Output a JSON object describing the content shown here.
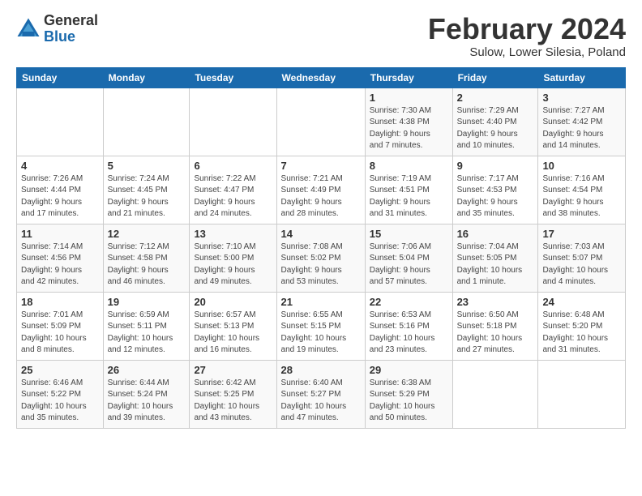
{
  "header": {
    "logo_general": "General",
    "logo_blue": "Blue",
    "month_title": "February 2024",
    "location": "Sulow, Lower Silesia, Poland"
  },
  "calendar": {
    "days_of_week": [
      "Sunday",
      "Monday",
      "Tuesday",
      "Wednesday",
      "Thursday",
      "Friday",
      "Saturday"
    ],
    "weeks": [
      [
        {
          "day": "",
          "info": ""
        },
        {
          "day": "",
          "info": ""
        },
        {
          "day": "",
          "info": ""
        },
        {
          "day": "",
          "info": ""
        },
        {
          "day": "1",
          "info": "Sunrise: 7:30 AM\nSunset: 4:38 PM\nDaylight: 9 hours\nand 7 minutes."
        },
        {
          "day": "2",
          "info": "Sunrise: 7:29 AM\nSunset: 4:40 PM\nDaylight: 9 hours\nand 10 minutes."
        },
        {
          "day": "3",
          "info": "Sunrise: 7:27 AM\nSunset: 4:42 PM\nDaylight: 9 hours\nand 14 minutes."
        }
      ],
      [
        {
          "day": "4",
          "info": "Sunrise: 7:26 AM\nSunset: 4:44 PM\nDaylight: 9 hours\nand 17 minutes."
        },
        {
          "day": "5",
          "info": "Sunrise: 7:24 AM\nSunset: 4:45 PM\nDaylight: 9 hours\nand 21 minutes."
        },
        {
          "day": "6",
          "info": "Sunrise: 7:22 AM\nSunset: 4:47 PM\nDaylight: 9 hours\nand 24 minutes."
        },
        {
          "day": "7",
          "info": "Sunrise: 7:21 AM\nSunset: 4:49 PM\nDaylight: 9 hours\nand 28 minutes."
        },
        {
          "day": "8",
          "info": "Sunrise: 7:19 AM\nSunset: 4:51 PM\nDaylight: 9 hours\nand 31 minutes."
        },
        {
          "day": "9",
          "info": "Sunrise: 7:17 AM\nSunset: 4:53 PM\nDaylight: 9 hours\nand 35 minutes."
        },
        {
          "day": "10",
          "info": "Sunrise: 7:16 AM\nSunset: 4:54 PM\nDaylight: 9 hours\nand 38 minutes."
        }
      ],
      [
        {
          "day": "11",
          "info": "Sunrise: 7:14 AM\nSunset: 4:56 PM\nDaylight: 9 hours\nand 42 minutes."
        },
        {
          "day": "12",
          "info": "Sunrise: 7:12 AM\nSunset: 4:58 PM\nDaylight: 9 hours\nand 46 minutes."
        },
        {
          "day": "13",
          "info": "Sunrise: 7:10 AM\nSunset: 5:00 PM\nDaylight: 9 hours\nand 49 minutes."
        },
        {
          "day": "14",
          "info": "Sunrise: 7:08 AM\nSunset: 5:02 PM\nDaylight: 9 hours\nand 53 minutes."
        },
        {
          "day": "15",
          "info": "Sunrise: 7:06 AM\nSunset: 5:04 PM\nDaylight: 9 hours\nand 57 minutes."
        },
        {
          "day": "16",
          "info": "Sunrise: 7:04 AM\nSunset: 5:05 PM\nDaylight: 10 hours\nand 1 minute."
        },
        {
          "day": "17",
          "info": "Sunrise: 7:03 AM\nSunset: 5:07 PM\nDaylight: 10 hours\nand 4 minutes."
        }
      ],
      [
        {
          "day": "18",
          "info": "Sunrise: 7:01 AM\nSunset: 5:09 PM\nDaylight: 10 hours\nand 8 minutes."
        },
        {
          "day": "19",
          "info": "Sunrise: 6:59 AM\nSunset: 5:11 PM\nDaylight: 10 hours\nand 12 minutes."
        },
        {
          "day": "20",
          "info": "Sunrise: 6:57 AM\nSunset: 5:13 PM\nDaylight: 10 hours\nand 16 minutes."
        },
        {
          "day": "21",
          "info": "Sunrise: 6:55 AM\nSunset: 5:15 PM\nDaylight: 10 hours\nand 19 minutes."
        },
        {
          "day": "22",
          "info": "Sunrise: 6:53 AM\nSunset: 5:16 PM\nDaylight: 10 hours\nand 23 minutes."
        },
        {
          "day": "23",
          "info": "Sunrise: 6:50 AM\nSunset: 5:18 PM\nDaylight: 10 hours\nand 27 minutes."
        },
        {
          "day": "24",
          "info": "Sunrise: 6:48 AM\nSunset: 5:20 PM\nDaylight: 10 hours\nand 31 minutes."
        }
      ],
      [
        {
          "day": "25",
          "info": "Sunrise: 6:46 AM\nSunset: 5:22 PM\nDaylight: 10 hours\nand 35 minutes."
        },
        {
          "day": "26",
          "info": "Sunrise: 6:44 AM\nSunset: 5:24 PM\nDaylight: 10 hours\nand 39 minutes."
        },
        {
          "day": "27",
          "info": "Sunrise: 6:42 AM\nSunset: 5:25 PM\nDaylight: 10 hours\nand 43 minutes."
        },
        {
          "day": "28",
          "info": "Sunrise: 6:40 AM\nSunset: 5:27 PM\nDaylight: 10 hours\nand 47 minutes."
        },
        {
          "day": "29",
          "info": "Sunrise: 6:38 AM\nSunset: 5:29 PM\nDaylight: 10 hours\nand 50 minutes."
        },
        {
          "day": "",
          "info": ""
        },
        {
          "day": "",
          "info": ""
        }
      ]
    ]
  }
}
